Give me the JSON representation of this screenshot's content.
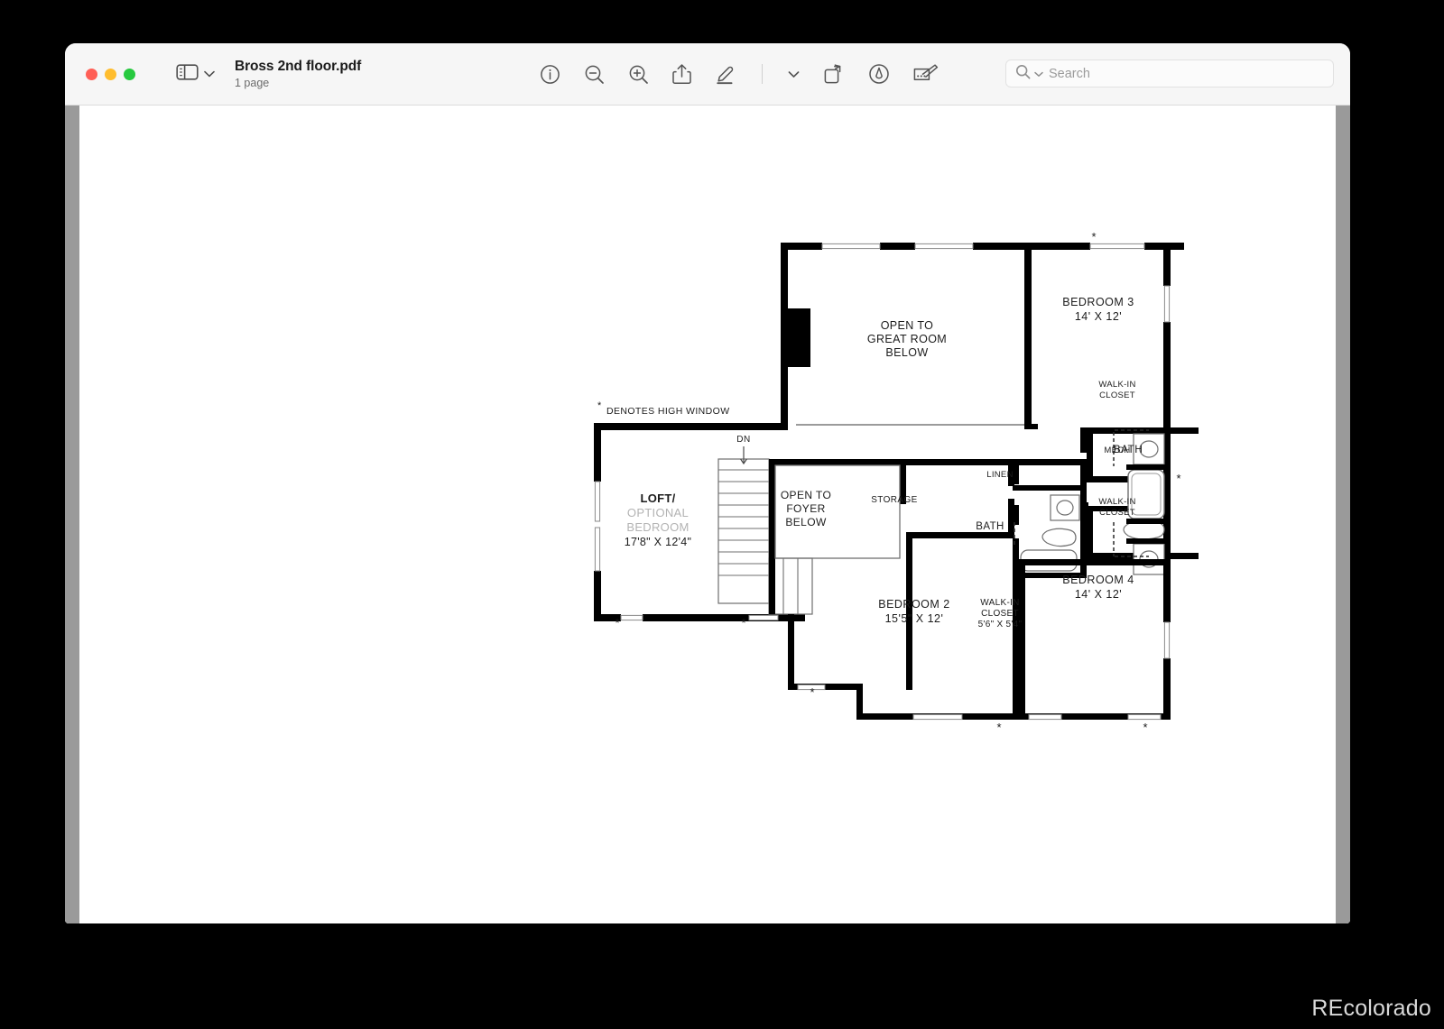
{
  "window": {
    "traffic_lights": [
      "close",
      "minimize",
      "zoom"
    ],
    "colors": {
      "close": "#ff5f56",
      "minimize": "#ffbd2e",
      "zoom": "#27c93f"
    }
  },
  "titlebar": {
    "sidebar_toggle_label": "sidebar-toggle",
    "doc_title": "Bross 2nd floor.pdf",
    "doc_subtitle": "1 page",
    "tools": [
      {
        "name": "info-icon",
        "label": "Info"
      },
      {
        "name": "zoom-out-icon",
        "label": "Zoom Out"
      },
      {
        "name": "zoom-in-icon",
        "label": "Zoom In"
      },
      {
        "name": "share-icon",
        "label": "Share"
      },
      {
        "name": "highlight-icon",
        "label": "Highlight"
      },
      {
        "name": "chevron-down-icon",
        "label": "Highlight Options"
      },
      {
        "name": "rotate-icon",
        "label": "Rotate"
      },
      {
        "name": "annotate-icon",
        "label": "Annotate"
      },
      {
        "name": "markup-icon",
        "label": "Markup Toolbar"
      }
    ]
  },
  "search": {
    "value": "",
    "placeholder": "Search",
    "icon": "search-icon",
    "dropdown_icon": "chevron-down-icon"
  },
  "plan": {
    "note_symbol": "*",
    "note_text": "DENOTES HIGH WINDOW",
    "stair_label": "DN",
    "rooms": [
      {
        "id": "open-great-room",
        "lines": [
          "OPEN TO",
          "GREAT ROOM",
          "BELOW"
        ]
      },
      {
        "id": "bedroom-3",
        "lines": [
          "BEDROOM 3",
          "14' X 12'"
        ]
      },
      {
        "id": "walk-in-closet-upper",
        "lines": [
          "WALK-IN",
          "CLOSET"
        ]
      },
      {
        "id": "mech",
        "lines": [
          "MECH"
        ]
      },
      {
        "id": "walk-in-closet-lower",
        "lines": [
          "WALK-IN",
          "CLOSET"
        ]
      },
      {
        "id": "bath-main",
        "lines": [
          "BATH"
        ]
      },
      {
        "id": "bedroom-4",
        "lines": [
          "BEDROOM 4",
          "14' X 12'"
        ]
      },
      {
        "id": "linen",
        "lines": [
          "LINEN"
        ]
      },
      {
        "id": "bath-hall",
        "lines": [
          "BATH"
        ]
      },
      {
        "id": "walk-in-closet-bed2",
        "lines": [
          "WALK-IN",
          "CLOSET",
          "5'6\" X 5'4\""
        ]
      },
      {
        "id": "storage",
        "lines": [
          "STORAGE"
        ]
      },
      {
        "id": "bedroom-2",
        "lines": [
          "BEDROOM 2",
          "15'5\" X 12'"
        ]
      },
      {
        "id": "open-foyer",
        "lines": [
          "OPEN TO",
          "FOYER",
          "BELOW"
        ]
      },
      {
        "id": "loft",
        "lines": [
          "LOFT/",
          "OPTIONAL",
          "BEDROOM",
          "17'8\" X 12'4\""
        ]
      }
    ],
    "labels": {
      "open_great_room_1": "OPEN TO",
      "open_great_room_2": "GREAT ROOM",
      "open_great_room_3": "BELOW",
      "bedroom3_name": "BEDROOM 3",
      "bedroom3_dims": "14' X 12'",
      "wic_upper_1": "WALK-IN",
      "wic_upper_2": "CLOSET",
      "mech": "MECH",
      "wic_lower_1": "WALK-IN",
      "wic_lower_2": "CLOSET",
      "bath_main": "BATH",
      "bedroom4_name": "BEDROOM 4",
      "bedroom4_dims": "14' X 12'",
      "linen": "LINEN",
      "bath_hall": "BATH",
      "wic_bed2_1": "WALK-IN",
      "wic_bed2_2": "CLOSET",
      "wic_bed2_3": "5'6\" X 5'4\"",
      "storage": "STORAGE",
      "bedroom2_name": "BEDROOM 2",
      "bedroom2_dims": "15'5\" X 12'",
      "open_foyer_1": "OPEN TO",
      "open_foyer_2": "FOYER",
      "open_foyer_3": "BELOW",
      "loft_1": "LOFT/",
      "loft_2": "OPTIONAL",
      "loft_3": "BEDROOM",
      "loft_4": "17'8\" X 12'4\"",
      "note_symbol": "*",
      "note_text": "DENOTES HIGH WINDOW",
      "dn": "DN"
    },
    "high_window_markers": 6,
    "colors": {
      "wall": "#000000",
      "thin_line": "#6f6f6f",
      "text": "#1c1c1c",
      "optional_text": "#b0b0b0",
      "paper": "#ffffff"
    }
  },
  "watermark": {
    "text": "REcolorado"
  }
}
